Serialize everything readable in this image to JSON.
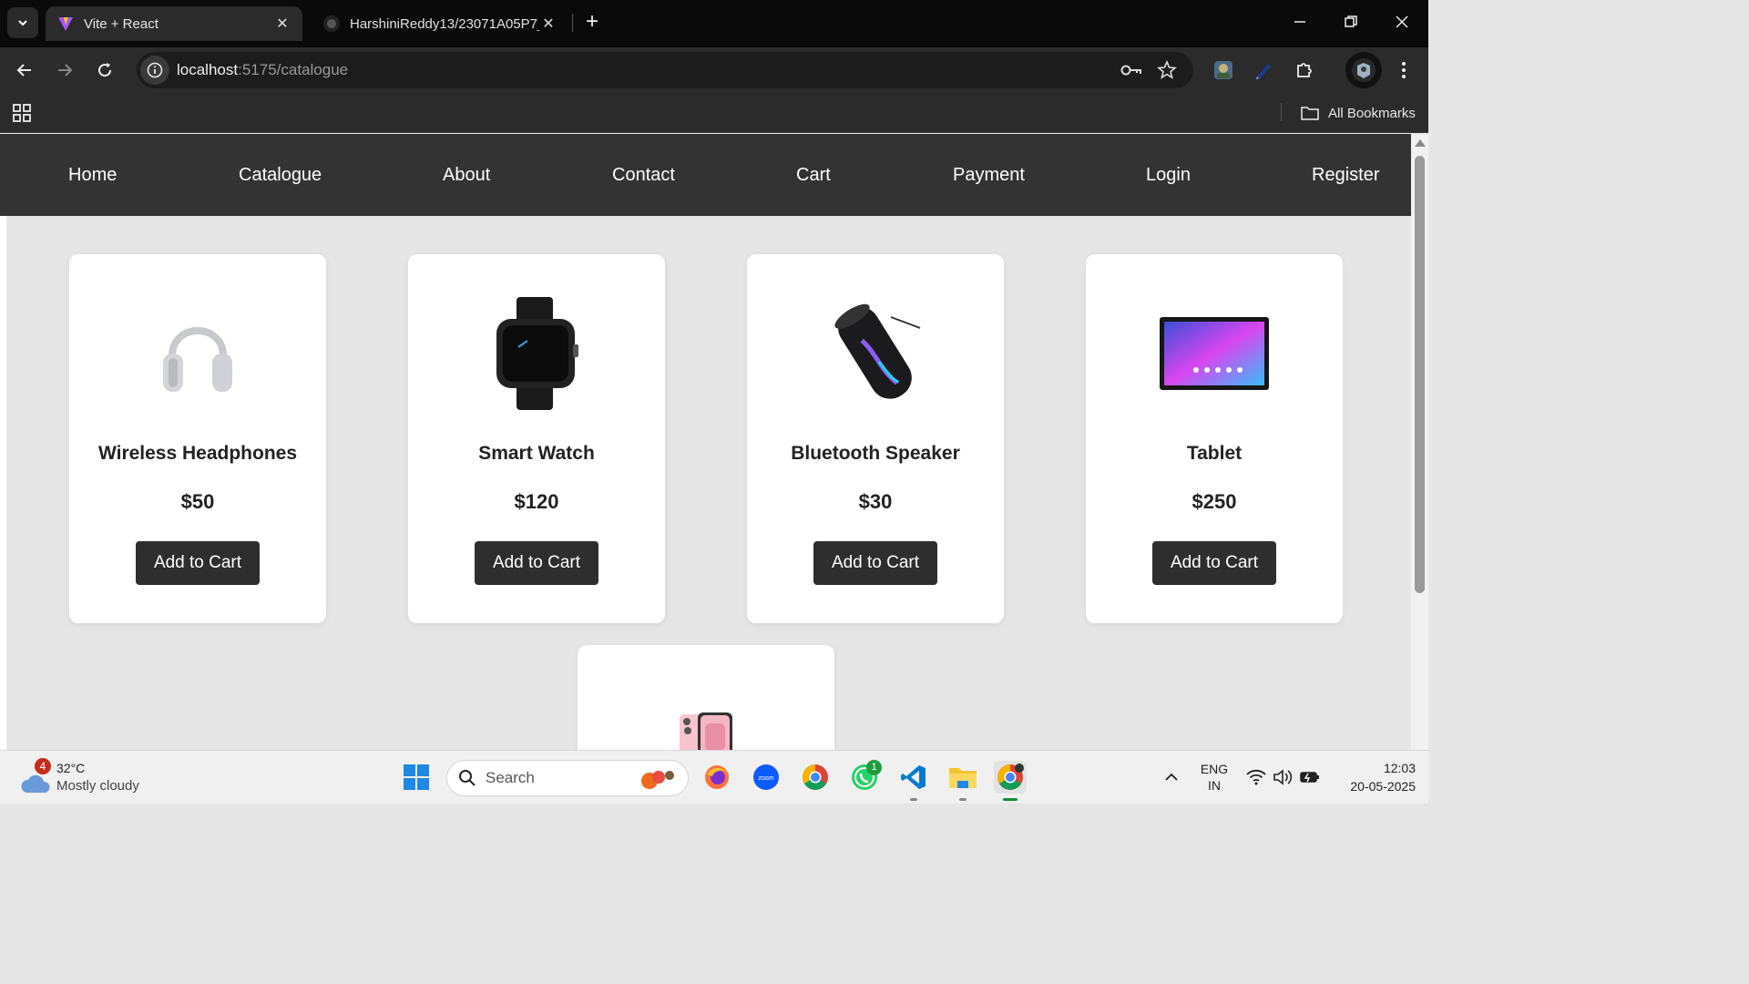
{
  "browser": {
    "tabs": [
      {
        "title": "Vite + React",
        "active": true,
        "icon": "vite-icon"
      },
      {
        "title": "HarshiniReddy13/23071A05P7_",
        "active": false,
        "icon": "github-icon"
      }
    ],
    "new_tab_label": "+",
    "address": {
      "host": "localhost",
      "path": ":5175/catalogue"
    },
    "bookmarks_label": "All Bookmarks"
  },
  "site": {
    "nav": [
      "Home",
      "Catalogue",
      "About",
      "Contact",
      "Cart",
      "Payment",
      "Login",
      "Register"
    ],
    "products": [
      {
        "name": "Wireless Headphones",
        "price": "$50",
        "button": "Add to Cart",
        "image": "headphones-image"
      },
      {
        "name": "Smart Watch",
        "price": "$120",
        "button": "Add to Cart",
        "image": "smartwatch-image"
      },
      {
        "name": "Bluetooth Speaker",
        "price": "$30",
        "button": "Add to Cart",
        "image": "speaker-image"
      },
      {
        "name": "Tablet",
        "price": "$250",
        "button": "Add to Cart",
        "image": "tablet-image"
      },
      {
        "name": "",
        "price": "",
        "button": "",
        "image": "phone-image"
      }
    ]
  },
  "taskbar": {
    "weather": {
      "temp": "32°C",
      "condition": "Mostly cloudy",
      "badge": "4"
    },
    "search_placeholder": "Search",
    "whatsapp_badge": "1",
    "language": {
      "line1": "ENG",
      "line2": "IN"
    },
    "time": "12:03",
    "date": "20-05-2025"
  },
  "colors": {
    "nav_bg": "#333333",
    "button_bg": "#2e2e2e",
    "page_bg": "#e6e6e6"
  }
}
